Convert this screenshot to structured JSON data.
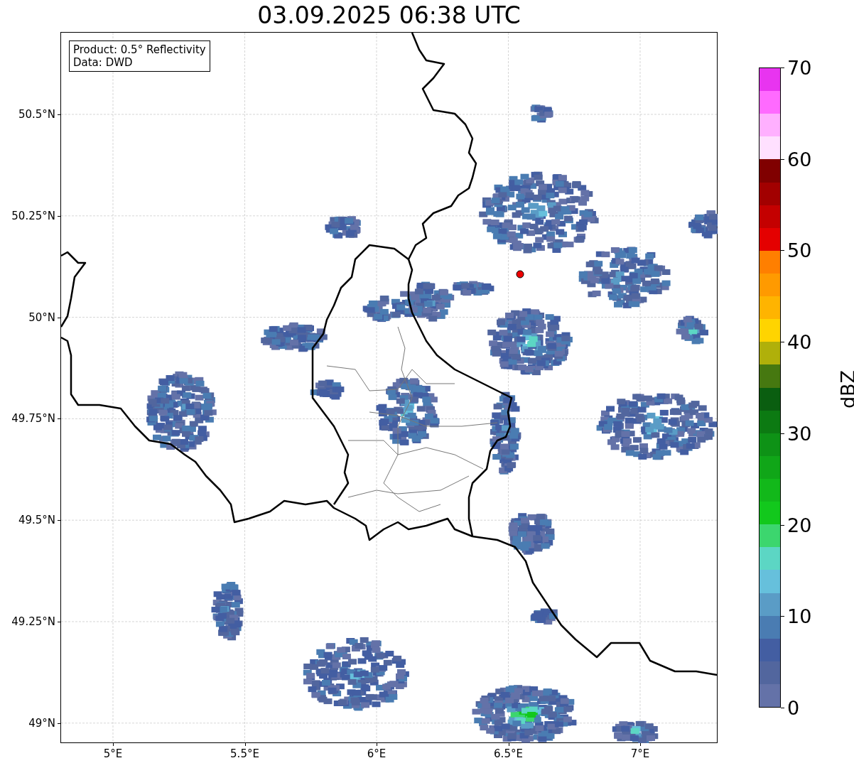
{
  "title": "03.09.2025 06:38 UTC",
  "info_box": {
    "lines": [
      "Product: 0.5° Reflectivity",
      "Data: DWD"
    ]
  },
  "map": {
    "x_ticks": [
      "5°E",
      "5.5°E",
      "6°E",
      "6.5°E",
      "7°E"
    ],
    "y_ticks": [
      "50.5°N",
      "50.25°N",
      "50°N",
      "49.75°N",
      "49.5°N",
      "49.25°N",
      "49°N"
    ]
  },
  "colorbar": {
    "label": "dBZ",
    "ticks": [
      "70",
      "60",
      "50",
      "40",
      "30",
      "20",
      "10",
      "0"
    ],
    "segments": [
      {
        "color": "#e834f0"
      },
      {
        "color": "#ff6aff"
      },
      {
        "color": "#ffb0ff"
      },
      {
        "color": "#ffe0ff"
      },
      {
        "color": "#800000"
      },
      {
        "color": "#a20000"
      },
      {
        "color": "#c40000"
      },
      {
        "color": "#e40000"
      },
      {
        "color": "#ff7f00"
      },
      {
        "color": "#ff9a00"
      },
      {
        "color": "#ffb400"
      },
      {
        "color": "#ffd400"
      },
      {
        "color": "#b0b00a"
      },
      {
        "color": "#467810"
      },
      {
        "color": "#0a5e10"
      },
      {
        "color": "#0c7a12"
      },
      {
        "color": "#0e9216"
      },
      {
        "color": "#10a618"
      },
      {
        "color": "#12b81a"
      },
      {
        "color": "#12c81c"
      },
      {
        "color": "#3cd66e"
      },
      {
        "color": "#5cd6c4"
      },
      {
        "color": "#66c0dc"
      },
      {
        "color": "#5a9cc6"
      },
      {
        "color": "#4a7cb2"
      },
      {
        "color": "#435ea2"
      },
      {
        "color": "#52669e"
      },
      {
        "color": "#6472a8"
      }
    ]
  }
}
